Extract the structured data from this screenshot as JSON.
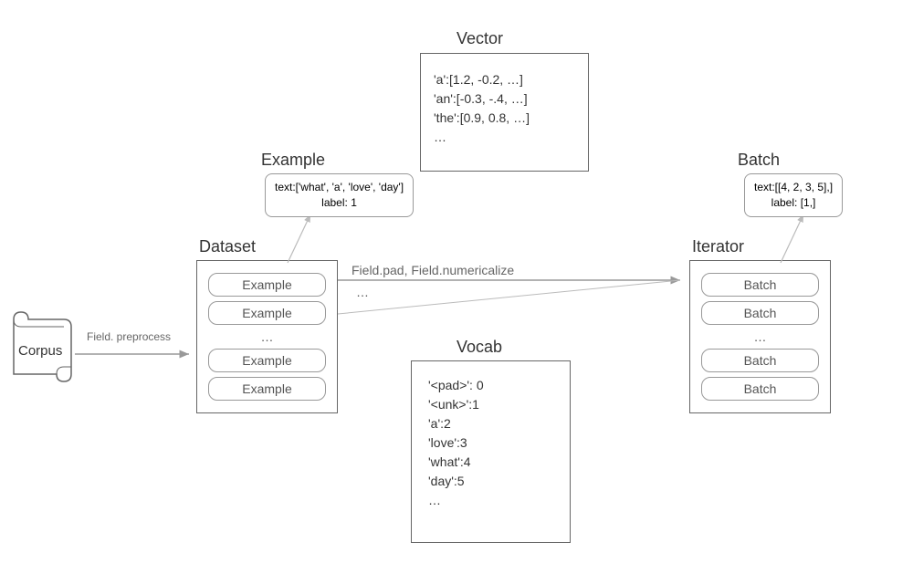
{
  "corpus": {
    "label": "Corpus"
  },
  "arrows": {
    "preprocess": "Field. preprocess",
    "pad_num": "Field.pad, Field.numericalize"
  },
  "dataset": {
    "title": "Dataset",
    "item_label": "Example",
    "ellipsis": "…"
  },
  "example_detail": {
    "title": "Example",
    "text_label": "text:['what', 'a', 'love', 'day']",
    "label_label": "label: 1"
  },
  "vector": {
    "title": "Vector",
    "lines": "'a':[1.2, -0.2, …]\n'an':[-0.3, -.4, …]\n'the':[0.9, 0.8, …]\n…"
  },
  "vocab": {
    "title": "Vocab",
    "lines": "'<pad>': 0\n'<unk>':1\n'a':2\n'love':3\n'what':4\n'day':5\n…"
  },
  "iterator": {
    "title": "Iterator",
    "item_label": "Batch",
    "ellipsis": "…"
  },
  "batch_detail": {
    "title": "Batch",
    "text_label": "text:[[4, 2, 3, 5],]",
    "label_label": "label: [1,]"
  }
}
